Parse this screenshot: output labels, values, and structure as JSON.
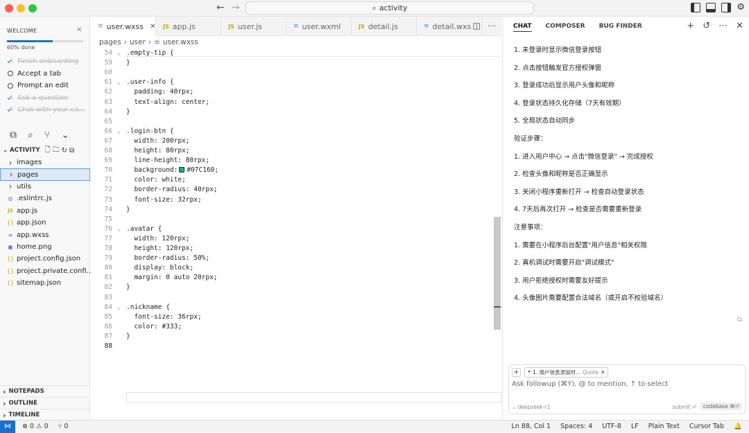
{
  "window": {
    "search_text": "activity"
  },
  "welcome": {
    "title": "WELCOME",
    "progress_percent": 60,
    "progress_label": "60% done",
    "tasks": [
      {
        "label": "Finish onboarding",
        "done": true
      },
      {
        "label": "Accept a tab",
        "done": false
      },
      {
        "label": "Prompt an edit",
        "done": false
      },
      {
        "label": "Ask a question",
        "done": true
      },
      {
        "label": "Chat with your co...",
        "done": true
      }
    ]
  },
  "explorer": {
    "title": "ACTIVITY",
    "items": [
      {
        "label": "images",
        "icon": "chevron-right-icon",
        "glyph": "›"
      },
      {
        "label": "pages",
        "icon": "chevron-right-icon",
        "glyph": "›",
        "selected": true
      },
      {
        "label": "utils",
        "icon": "chevron-right-icon",
        "glyph": "›"
      },
      {
        "label": ".eslintrc.js",
        "icon": "eslint-icon",
        "glyph": "◎"
      },
      {
        "label": "app.js",
        "icon": "js-file-icon",
        "glyph": "JS"
      },
      {
        "label": "app.json",
        "icon": "json-file-icon",
        "glyph": "{}"
      },
      {
        "label": "app.wxss",
        "icon": "css-file-icon",
        "glyph": "≡"
      },
      {
        "label": "home.png",
        "icon": "image-file-icon",
        "glyph": "▣"
      },
      {
        "label": "project.config.json",
        "icon": "json-file-icon",
        "glyph": "{}"
      },
      {
        "label": "project.private.confi...",
        "icon": "json-file-icon",
        "glyph": "{}"
      },
      {
        "label": "sitemap.json",
        "icon": "json-file-icon",
        "glyph": "{}"
      }
    ],
    "sections": [
      "NOTEPADS",
      "OUTLINE",
      "TIMELINE"
    ]
  },
  "tabs": [
    {
      "label": "user.wxss",
      "kind": "css",
      "active": true
    },
    {
      "label": "app.js",
      "kind": "js"
    },
    {
      "label": "user.js",
      "kind": "js"
    },
    {
      "label": "user.wxml",
      "kind": "css"
    },
    {
      "label": "detail.js",
      "kind": "js"
    },
    {
      "label": "detail.wxs",
      "kind": "css"
    }
  ],
  "breadcrumb": [
    "pages",
    "user",
    "user.wxss"
  ],
  "code_lines": [
    {
      "n": "54",
      "text": ".empty-tip {",
      "fold": true
    },
    {
      "n": "59",
      "text": "}"
    },
    {
      "n": "60",
      "text": ""
    },
    {
      "n": "61",
      "text": ".user-info {",
      "fold": true
    },
    {
      "n": "62",
      "text": "  padding: 40rpx;"
    },
    {
      "n": "63",
      "text": "  text-align: center;"
    },
    {
      "n": "64",
      "text": "}"
    },
    {
      "n": "65",
      "text": ""
    },
    {
      "n": "66",
      "text": ".login-btn {",
      "fold": true
    },
    {
      "n": "67",
      "text": "  width: 200rpx;"
    },
    {
      "n": "68",
      "text": "  height: 80rpx;"
    },
    {
      "n": "69",
      "text": "  line-height: 80rpx;"
    },
    {
      "n": "70",
      "text": "  background:",
      "swatch": true,
      "after": "#07C160;"
    },
    {
      "n": "71",
      "text": "  color: white;"
    },
    {
      "n": "72",
      "text": "  border-radius: 40rpx;"
    },
    {
      "n": "73",
      "text": "  font-size: 32rpx;"
    },
    {
      "n": "74",
      "text": "}"
    },
    {
      "n": "75",
      "text": ""
    },
    {
      "n": "76",
      "text": ".avatar {",
      "fold": true
    },
    {
      "n": "77",
      "text": "  width: 120rpx;"
    },
    {
      "n": "78",
      "text": "  height: 120rpx;"
    },
    {
      "n": "79",
      "text": "  border-radius: 50%;"
    },
    {
      "n": "80",
      "text": "  display: block;"
    },
    {
      "n": "81",
      "text": "  margin: 0 auto 20rpx;"
    },
    {
      "n": "82",
      "text": "}"
    },
    {
      "n": "83",
      "text": ""
    },
    {
      "n": "84",
      "text": ".nickname {",
      "fold": true
    },
    {
      "n": "85",
      "text": "  font-size: 36rpx;"
    },
    {
      "n": "86",
      "text": "  color: #333;"
    },
    {
      "n": "87",
      "text": "}"
    },
    {
      "n": "88",
      "text": "",
      "current": true
    }
  ],
  "chat": {
    "tabs": [
      "CHAT",
      "COMPOSER",
      "BUG FINDER"
    ],
    "messages": [
      "1. 未登录时显示微信登录按钮",
      "2. 点击按钮触发官方授权弹窗",
      "3. 登录成功后显示用户头像和昵称",
      "4. 登录状态持久化存储（7天有效期）",
      "5. 全局状态自动同步",
      "验证步骤：",
      "1. 进入用户中心 → 点击\"微信登录\" → 完成授权",
      "2. 检查头像和昵称是否正确显示",
      "3. 关闭小程序重新打开 → 检查自动登录状态",
      "4. 7天后再次打开 → 检查是否需要重新登录",
      "注意事项：",
      "1. 需要在小程序后台配置\"用户信息\"相关权限",
      "2. 真机调试时需要开启\"调试模式\"",
      "3. 用户拒绝授权时需要友好提示",
      "4. 头像图片需要配置合法域名（或开启不校验域名）"
    ],
    "composer": {
      "chip_text": "1. 用户信息添加时...",
      "chip_tag": "Quote",
      "placeholder": "Ask followup (⌘Y), @ to mention, ↑ to select",
      "model": "deepseek-r1",
      "submit_label": "submit ⏎",
      "codebase_label": "codebase ⌘⏎"
    }
  },
  "status": {
    "errors": "0",
    "warnings": "0",
    "ports": "0",
    "position": "Ln 88, Col 1",
    "spaces": "Spaces: 4",
    "encoding": "UTF-8",
    "eol": "LF",
    "language": "Plain Text",
    "tab_mode": "Cursor Tab"
  }
}
